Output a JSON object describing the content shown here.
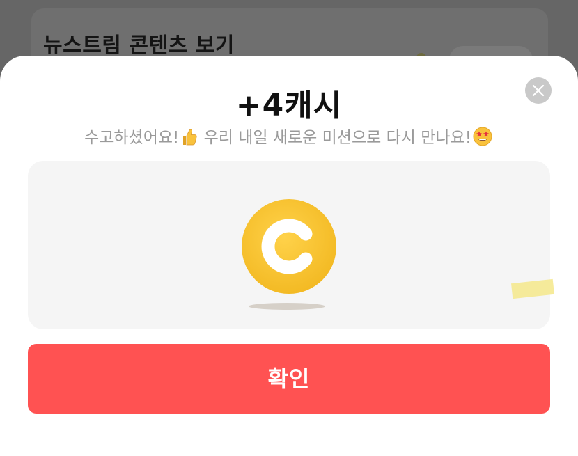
{
  "background": {
    "card_title": "뉴스트림 콘텐츠 보기"
  },
  "modal": {
    "title": "+4캐시",
    "subtitle_part1": "수고하셨어요!",
    "subtitle_part2": " 우리 내일 새로운 미션으로 다시 만나요!",
    "subtitle_emoji1": "thumbs-up-icon",
    "subtitle_emoji2": "star-struck-face-icon",
    "close_icon": "close-icon",
    "reward_icon": "cash-coin-icon",
    "confirm_label": "확인"
  },
  "colors": {
    "overlay": "#666666",
    "confirm_button": "#ff5252",
    "coin": "#f7c531",
    "subtitle_text": "#9a9a9a"
  }
}
